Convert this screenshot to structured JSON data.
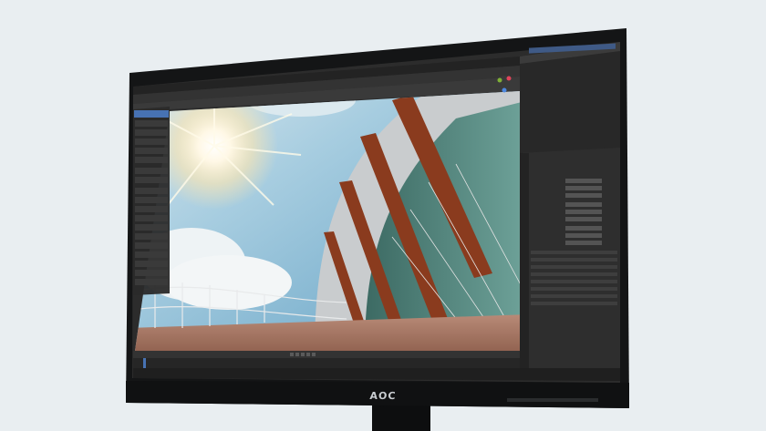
{
  "monitor": {
    "brand_logo": "AOC",
    "bezel_color": "#141516",
    "stand_color": "#0d0e0f",
    "background_color": "#e9eef1"
  },
  "screen": {
    "app_theme": "dark-3d-editor",
    "viewport_content": "architectural-render-with-sun",
    "sky_color": "#8ec0d8",
    "facade_accent": "#8a3b1e"
  }
}
